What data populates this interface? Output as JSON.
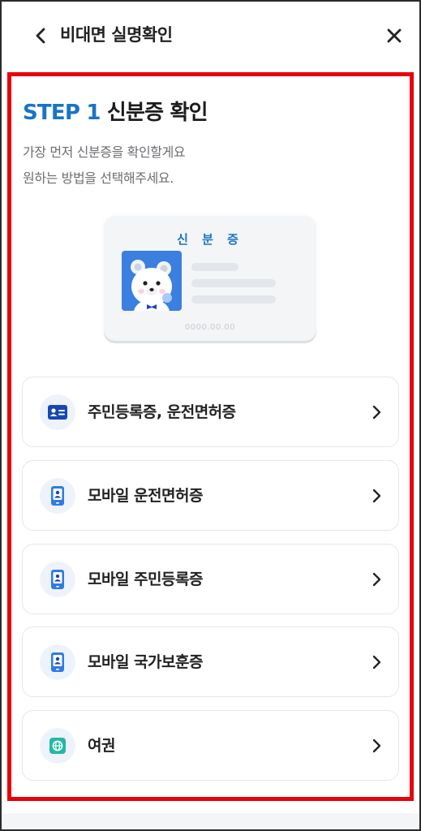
{
  "header": {
    "back_icon": "chevron-left-icon",
    "title": "비대면 실명확인",
    "close_icon": "close-icon"
  },
  "step": {
    "number": "STEP 1",
    "title": "신분증 확인"
  },
  "description": {
    "line1": "가장 먼저 신분증을 확인할게요",
    "line2": "원하는 방법을 선택해주세요."
  },
  "id_card": {
    "title": "신 분 증",
    "date": "0000.00.00"
  },
  "options": [
    {
      "label": "주민등록증, 운전면허증",
      "icon": "id-card-icon"
    },
    {
      "label": "모바일 운전면허증",
      "icon": "mobile-id-icon"
    },
    {
      "label": "모바일 주민등록증",
      "icon": "mobile-id-icon"
    },
    {
      "label": "모바일 국가보훈증",
      "icon": "mobile-id-icon"
    },
    {
      "label": "여권",
      "icon": "passport-icon"
    }
  ],
  "colors": {
    "accent": "#1a73c9",
    "highlight_border": "#e8000b",
    "text_primary": "#222222",
    "text_secondary": "#6e6e73"
  }
}
